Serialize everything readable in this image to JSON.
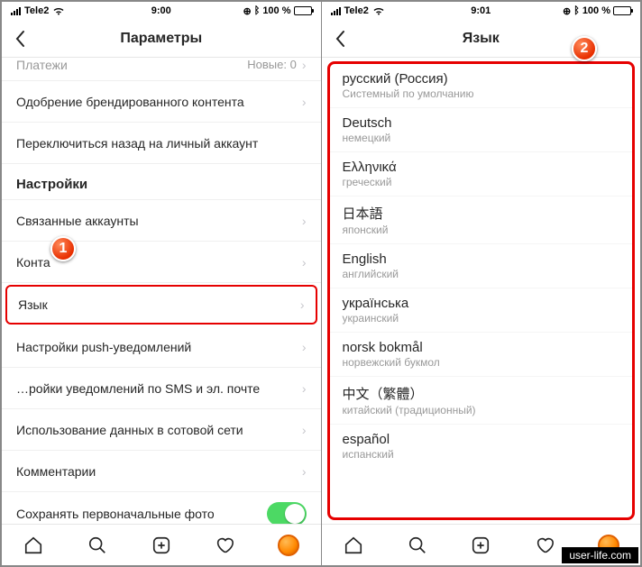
{
  "status": {
    "carrier": "Tele2",
    "time_left": "9:00",
    "time_right": "9:01",
    "battery": "100 %"
  },
  "left": {
    "title": "Параметры",
    "items": {
      "payments": {
        "label": "Платежи",
        "badge": "Новые: 0"
      },
      "branded": {
        "label": "Одобрение брендированного контента"
      },
      "switch_personal": {
        "label": "Переключиться назад на личный аккаунт"
      },
      "section": "Настройки",
      "linked": {
        "label": "Связанные аккаунты"
      },
      "contacts": {
        "label": "Конта"
      },
      "language": {
        "label": "Язык"
      },
      "push": {
        "label": "Настройки push-уведомлений"
      },
      "sms": {
        "label": "…ройки уведомлений по SMS и эл. почте"
      },
      "cellular": {
        "label": "Использование данных в сотовой сети"
      },
      "comments": {
        "label": "Комментарии"
      },
      "save_photo": {
        "label": "Сохранять первоначальные фото"
      }
    }
  },
  "right": {
    "title": "Язык",
    "langs": [
      {
        "name": "русский (Россия)",
        "sub": "Системный по умолчанию"
      },
      {
        "name": "Deutsch",
        "sub": "немецкий"
      },
      {
        "name": "Ελληνικά",
        "sub": "греческий"
      },
      {
        "name": "日本語",
        "sub": "японский"
      },
      {
        "name": "English",
        "sub": "английский"
      },
      {
        "name": "українська",
        "sub": "украинский"
      },
      {
        "name": "norsk bokmål",
        "sub": "норвежский букмол"
      },
      {
        "name": "中文（繁體）",
        "sub": "китайский (традиционный)"
      },
      {
        "name": "español",
        "sub": "испанский"
      }
    ]
  },
  "callouts": {
    "one": "1",
    "two": "2"
  },
  "watermark": "user-life.com"
}
